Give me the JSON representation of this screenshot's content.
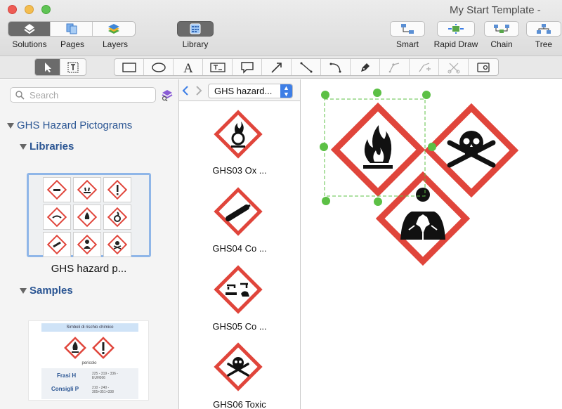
{
  "window": {
    "title": "My Start Template -"
  },
  "toolbar": {
    "solutions_label": "Solutions",
    "pages_label": "Pages",
    "layers_label": "Layers",
    "library_label": "Library",
    "smart_label": "Smart",
    "rapid_draw_label": "Rapid Draw",
    "chain_label": "Chain",
    "tree_label": "Tree"
  },
  "sidebar": {
    "search_placeholder": "Search",
    "root_label": "GHS Hazard Pictograms",
    "libraries_label": "Libraries",
    "library_thumb_label": "GHS hazard p...",
    "samples_label": "Samples",
    "sample_card": {
      "header": "Simboli di rischio chimico",
      "caption": "pericolo",
      "row1_label": "Frasi H",
      "row1_value": "225 - 319 - 336 - EUH066",
      "row2_label": "Consigli P",
      "row2_value": "210 - 240 - 305+351+338"
    }
  },
  "library": {
    "selected": "GHS hazard...",
    "items": [
      {
        "label": "GHS03 Ox ..."
      },
      {
        "label": "GHS04 Co ..."
      },
      {
        "label": "GHS05 Co ..."
      },
      {
        "label": "GHS06 Toxic"
      }
    ]
  },
  "colors": {
    "hazard_red": "#e0453b",
    "selection_green": "#5cc045",
    "accent_blue": "#3d7ee6"
  }
}
